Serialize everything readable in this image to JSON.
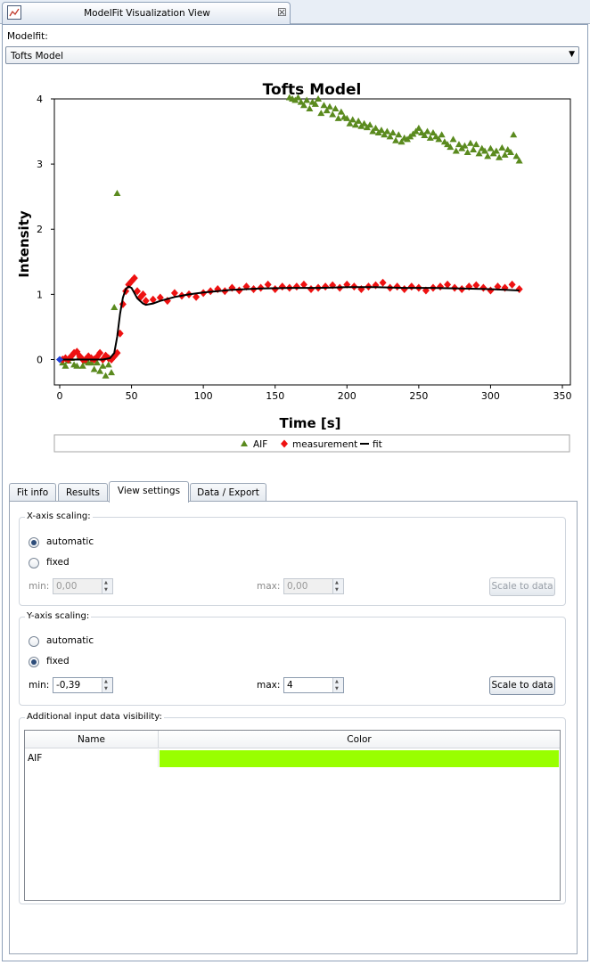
{
  "window": {
    "view_title": "ModelFit Visualization View"
  },
  "selector": {
    "label": "Modelfit:",
    "value": "Tofts Model"
  },
  "tabs": [
    "Fit info",
    "Results",
    "View settings",
    "Data / Export"
  ],
  "x_scaling": {
    "title": "X-axis scaling:",
    "automatic": "automatic",
    "fixed": "fixed",
    "selected": "automatic",
    "min_label": "min:",
    "min_value": "0,00",
    "max_label": "max:",
    "max_value": "0,00",
    "button": "Scale to data"
  },
  "y_scaling": {
    "title": "Y-axis scaling:",
    "automatic": "automatic",
    "fixed": "fixed",
    "selected": "fixed",
    "min_label": "min:",
    "min_value": "-0,39",
    "max_label": "max:",
    "max_value": "4",
    "button": "Scale to data"
  },
  "visibility": {
    "title": "Additional input data visibility:",
    "columns": [
      "Name",
      "Color"
    ],
    "rows": [
      {
        "name": "AIF",
        "color": "#99ff00"
      }
    ]
  },
  "chart_data": {
    "type": "scatter",
    "title": "Tofts Model",
    "xlabel": "Time [s]",
    "ylabel": "Intensity",
    "xlim": [
      0,
      350
    ],
    "ylim": [
      -0.39,
      4
    ],
    "xticks": [
      0,
      50,
      100,
      150,
      200,
      250,
      300,
      350
    ],
    "yticks": [
      0,
      1,
      2,
      3,
      4
    ],
    "legend": "bottom",
    "colors": {
      "AIF": "#5a8a1e",
      "measurement": "#ee1111",
      "fit": "#000000",
      "origin": "#1f3fd6"
    },
    "series": [
      {
        "name": "AIF",
        "marker": "triangle",
        "x": [
          2,
          4,
          6,
          8,
          10,
          12,
          14,
          16,
          18,
          20,
          22,
          24,
          26,
          28,
          30,
          32,
          34,
          36,
          38,
          40,
          160,
          162,
          164,
          166,
          168,
          170,
          172,
          174,
          176,
          178,
          180,
          182,
          184,
          186,
          188,
          190,
          192,
          194,
          196,
          198,
          200,
          202,
          204,
          206,
          208,
          210,
          212,
          214,
          216,
          218,
          220,
          222,
          224,
          226,
          228,
          230,
          232,
          234,
          236,
          238,
          240,
          242,
          244,
          246,
          248,
          250,
          252,
          254,
          256,
          258,
          260,
          262,
          264,
          266,
          268,
          270,
          272,
          274,
          276,
          278,
          280,
          282,
          284,
          286,
          288,
          290,
          292,
          294,
          296,
          298,
          300,
          302,
          304,
          306,
          308,
          310,
          312,
          314,
          316,
          318,
          320
        ],
        "y": [
          -0.05,
          -0.1,
          -0.02,
          0.02,
          -0.08,
          -0.1,
          0.05,
          -0.1,
          -0.03,
          -0.05,
          -0.05,
          -0.15,
          -0.05,
          -0.18,
          -0.1,
          -0.25,
          -0.08,
          -0.2,
          0.8,
          2.55,
          4.02,
          4.0,
          3.98,
          4.02,
          3.95,
          3.9,
          3.98,
          3.85,
          3.95,
          3.92,
          4.0,
          3.78,
          3.9,
          3.82,
          3.88,
          3.76,
          3.85,
          3.7,
          3.8,
          3.72,
          3.7,
          3.62,
          3.68,
          3.6,
          3.66,
          3.58,
          3.62,
          3.56,
          3.6,
          3.5,
          3.55,
          3.48,
          3.52,
          3.45,
          3.5,
          3.42,
          3.48,
          3.36,
          3.45,
          3.34,
          3.4,
          3.38,
          3.42,
          3.46,
          3.5,
          3.55,
          3.48,
          3.44,
          3.5,
          3.4,
          3.48,
          3.42,
          3.38,
          3.45,
          3.34,
          3.3,
          3.26,
          3.38,
          3.2,
          3.3,
          3.24,
          3.28,
          3.18,
          3.32,
          3.22,
          3.3,
          3.16,
          3.24,
          3.2,
          3.12,
          3.24,
          3.16,
          3.2,
          3.1,
          3.25,
          3.14,
          3.22,
          3.18,
          3.45,
          3.12,
          3.05
        ]
      },
      {
        "name": "measurement",
        "marker": "diamond",
        "x": [
          2,
          4,
          6,
          8,
          10,
          12,
          14,
          16,
          18,
          20,
          22,
          24,
          26,
          28,
          30,
          32,
          34,
          36,
          38,
          40,
          42,
          44,
          46,
          48,
          50,
          52,
          54,
          56,
          58,
          60,
          65,
          70,
          75,
          80,
          85,
          90,
          95,
          100,
          105,
          110,
          115,
          120,
          125,
          130,
          135,
          140,
          145,
          150,
          155,
          160,
          165,
          170,
          175,
          180,
          185,
          190,
          195,
          200,
          205,
          210,
          215,
          220,
          225,
          230,
          235,
          240,
          245,
          250,
          255,
          260,
          265,
          270,
          275,
          280,
          285,
          290,
          295,
          300,
          305,
          310,
          315,
          320
        ],
        "y": [
          0.0,
          0.02,
          0.0,
          0.05,
          0.1,
          0.12,
          0.05,
          0.0,
          0.0,
          0.05,
          0.02,
          0.0,
          0.04,
          0.1,
          0.0,
          0.06,
          0.02,
          0.0,
          0.05,
          0.1,
          0.4,
          0.85,
          1.05,
          1.15,
          1.2,
          1.25,
          1.05,
          0.95,
          1.0,
          0.9,
          0.92,
          0.95,
          0.9,
          1.02,
          0.98,
          1.0,
          0.96,
          1.02,
          1.05,
          1.08,
          1.05,
          1.1,
          1.06,
          1.12,
          1.08,
          1.1,
          1.15,
          1.08,
          1.12,
          1.1,
          1.12,
          1.15,
          1.08,
          1.1,
          1.12,
          1.14,
          1.1,
          1.15,
          1.12,
          1.08,
          1.12,
          1.14,
          1.18,
          1.1,
          1.12,
          1.08,
          1.12,
          1.1,
          1.06,
          1.1,
          1.12,
          1.15,
          1.1,
          1.08,
          1.12,
          1.14,
          1.1,
          1.06,
          1.12,
          1.1,
          1.15,
          1.08
        ]
      },
      {
        "name": "fit",
        "marker": "line",
        "x": [
          0,
          10,
          20,
          30,
          35,
          38,
          40,
          42,
          44,
          46,
          48,
          50,
          52,
          54,
          56,
          58,
          60,
          65,
          70,
          80,
          90,
          100,
          120,
          140,
          160,
          180,
          200,
          220,
          240,
          260,
          280,
          300,
          320
        ],
        "y": [
          0,
          0,
          0,
          0,
          0.02,
          0.1,
          0.35,
          0.7,
          0.95,
          1.08,
          1.12,
          1.1,
          1.02,
          0.94,
          0.9,
          0.86,
          0.84,
          0.86,
          0.9,
          0.96,
          1.0,
          1.03,
          1.07,
          1.09,
          1.1,
          1.1,
          1.11,
          1.11,
          1.1,
          1.1,
          1.09,
          1.08,
          1.06
        ]
      }
    ]
  }
}
